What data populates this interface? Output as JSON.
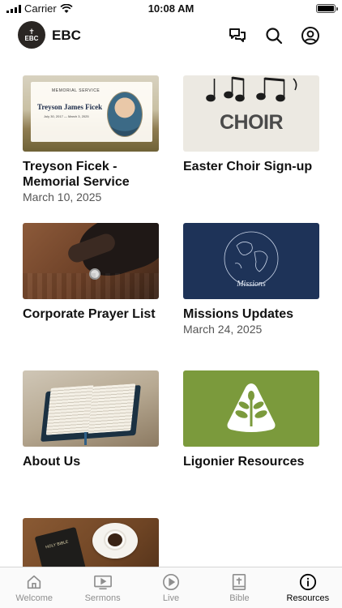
{
  "status": {
    "carrier": "Carrier",
    "time": "10:08 AM"
  },
  "header": {
    "logo_text": "EBC",
    "brand": "EBC"
  },
  "cards": [
    {
      "title": "Treyson Ficek - Memorial Service",
      "date": "March 10, 2025",
      "thumb_caption": "MEMORIAL SERVICE",
      "thumb_name": "Treyson James Ficek",
      "thumb_dates": "July 30, 2017 — March 3, 2025"
    },
    {
      "title": "Easter Choir Sign-up",
      "thumb_word": "CHOIR"
    },
    {
      "title": "Corporate Prayer List"
    },
    {
      "title": "Missions Updates",
      "date": "March 24, 2025",
      "thumb_word": "Missions"
    },
    {
      "title": "About Us"
    },
    {
      "title": "Ligonier Resources"
    },
    {
      "title": "",
      "thumb_word": "HOLY BIBLE"
    }
  ],
  "tabs": [
    {
      "label": "Welcome",
      "icon": "home-icon"
    },
    {
      "label": "Sermons",
      "icon": "video-icon"
    },
    {
      "label": "Live",
      "icon": "play-icon"
    },
    {
      "label": "Bible",
      "icon": "bible-icon"
    },
    {
      "label": "Resources",
      "icon": "info-icon",
      "active": true
    }
  ],
  "colors": {
    "missions_bg": "#1e3358",
    "ligonier_bg": "#7b9a3c",
    "choir_bg": "#ece9e2"
  }
}
